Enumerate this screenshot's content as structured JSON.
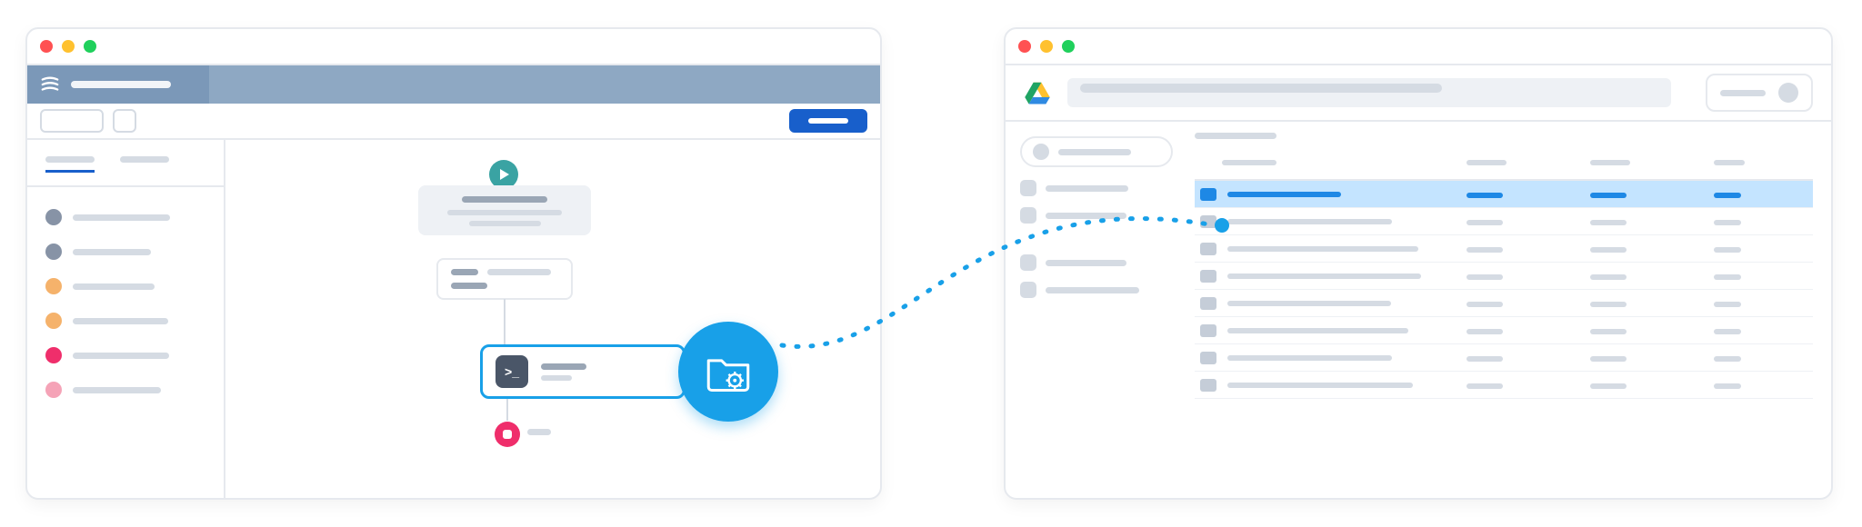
{
  "diagram": {
    "description": "Integration illustration: a workflow orchestration app (left window) with a selected task node pushes data into a folder in a Google-Drive-like file browser (right window), connected by a dotted path.",
    "connector": {
      "style": "dotted",
      "color": "#18a0e8",
      "from": "left.flow.folder_action_badge",
      "to": "right.table.selected_row_marker"
    }
  },
  "left": {
    "app_name": "",
    "header_title_placeholder": "",
    "toolbar": {
      "search_value": "",
      "primary_button_label": ""
    },
    "sidebar": {
      "tabs": [
        {
          "label": "",
          "active": true
        },
        {
          "label": "",
          "active": false
        }
      ],
      "items": [
        {
          "status_color": "#8793a6",
          "label": ""
        },
        {
          "status_color": "#8793a6",
          "label": ""
        },
        {
          "status_color": "#f5b26b",
          "label": ""
        },
        {
          "status_color": "#f5b26b",
          "label": ""
        },
        {
          "status_color": "#ef2e6b",
          "label": ""
        },
        {
          "status_color": "#f5a3b7",
          "label": ""
        }
      ]
    },
    "flow": {
      "start_node": {
        "type": "start",
        "label": ""
      },
      "task_card": {
        "title": "",
        "subtitle": "",
        "lines": [
          "",
          ""
        ]
      },
      "param_card": {
        "key": "",
        "value": ""
      },
      "selected_task": {
        "icon": "terminal-icon",
        "label": "",
        "selected": true
      },
      "stop_node": {
        "type": "stop",
        "label": ""
      },
      "folder_action_badge": {
        "icon": "folder-gear-icon",
        "color": "#18a0e8"
      }
    }
  },
  "right": {
    "app_name": "Google Drive",
    "search_placeholder": "",
    "account_label": "",
    "sidebar": {
      "new_button_label": "",
      "sections": [
        {
          "icon": "square",
          "label": ""
        },
        {
          "icon": "square",
          "label": ""
        }
      ],
      "sections2": [
        {
          "icon": "square",
          "label": ""
        },
        {
          "icon": "square",
          "label": ""
        }
      ]
    },
    "breadcrumb": [
      ""
    ],
    "columns": [
      "",
      "",
      "",
      ""
    ],
    "table": {
      "selected_index": 0,
      "rows": [
        {
          "name": "",
          "owner": "",
          "modified": "",
          "size": "",
          "selected": true
        },
        {
          "name": "",
          "owner": "",
          "modified": "",
          "size": "",
          "selected": false
        },
        {
          "name": "",
          "owner": "",
          "modified": "",
          "size": "",
          "selected": false
        },
        {
          "name": "",
          "owner": "",
          "modified": "",
          "size": "",
          "selected": false
        },
        {
          "name": "",
          "owner": "",
          "modified": "",
          "size": "",
          "selected": false
        },
        {
          "name": "",
          "owner": "",
          "modified": "",
          "size": "",
          "selected": false
        },
        {
          "name": "",
          "owner": "",
          "modified": "",
          "size": "",
          "selected": false
        },
        {
          "name": "",
          "owner": "",
          "modified": "",
          "size": "",
          "selected": false
        }
      ]
    }
  },
  "colors": {
    "accent_blue": "#18a0e8",
    "button_blue": "#185fcb",
    "slate_header": "#8ea8c3",
    "teal": "#3aa3a3",
    "pink": "#ef2e6b"
  }
}
